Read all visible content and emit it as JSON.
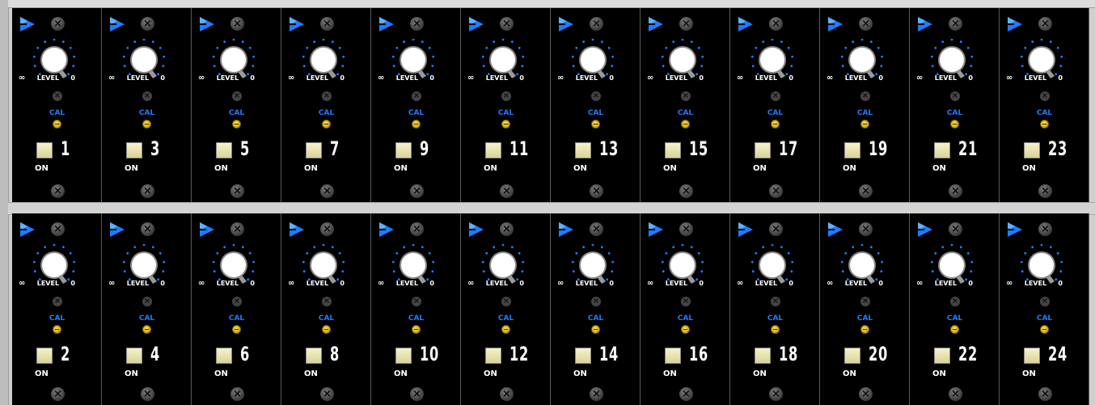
{
  "labels": {
    "level": "LEVEL",
    "infinity": "∞",
    "zero": "0",
    "cal": "CAL",
    "on": "ON",
    "screw_glyph": "×"
  },
  "icons": {
    "brand": "blue-triangle-logo-icon",
    "screw": "screw-icon",
    "knob": "level-knob-icon",
    "cal_trim": "cal-trim-screw-icon"
  },
  "colors": {
    "panel": "#000000",
    "accent_blue": "#1e7cff",
    "switch": "#f2efc2",
    "trim_yellow": "#ffd93a"
  },
  "rows": [
    {
      "channels": [
        "1",
        "3",
        "5",
        "7",
        "9",
        "11",
        "13",
        "15",
        "17",
        "19",
        "21",
        "23"
      ]
    },
    {
      "channels": [
        "2",
        "4",
        "6",
        "8",
        "10",
        "12",
        "14",
        "16",
        "18",
        "20",
        "22",
        "24"
      ]
    }
  ]
}
